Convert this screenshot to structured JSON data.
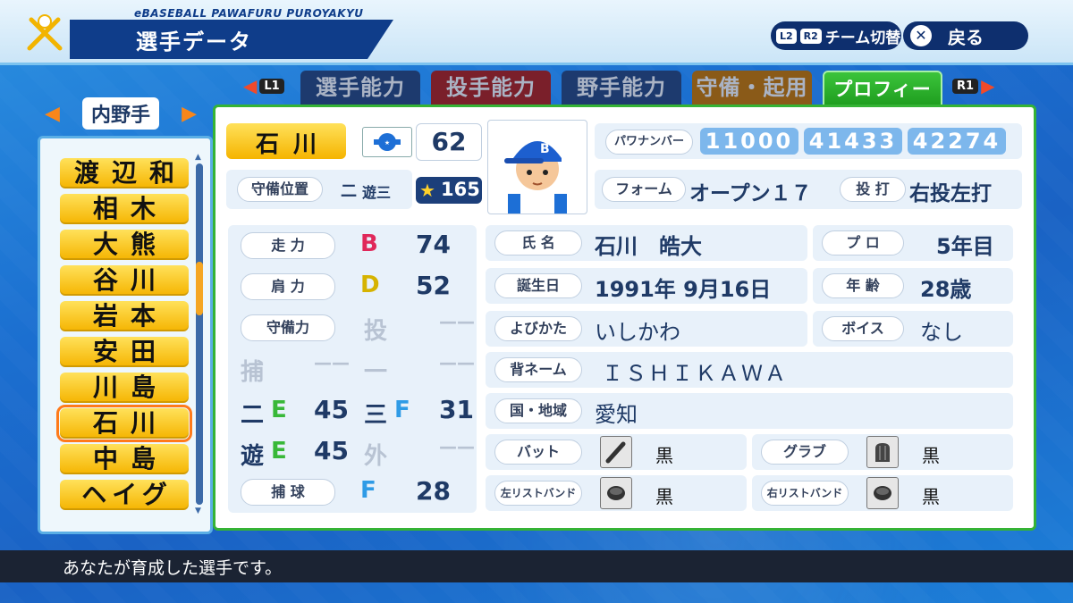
{
  "header": {
    "brand": "eBASEBALL PAWAFURU PUROYAKYU",
    "title": "選手データ",
    "team_switch_keys": [
      "L2",
      "R2"
    ],
    "team_switch_label": "チーム切替",
    "back_label": "戻る"
  },
  "tabs": {
    "left_key": "L1",
    "right_key": "R1",
    "items": [
      {
        "label": "選手能力",
        "color": "#1d3a6e"
      },
      {
        "label": "投手能力",
        "color": "#7a1f2a"
      },
      {
        "label": "野手能力",
        "color": "#1d3a6e"
      },
      {
        "label": "守備・起用",
        "color": "#8a5a18"
      },
      {
        "label": "プロフィール",
        "color": "#2aa82a",
        "active": true
      }
    ]
  },
  "position_selector": {
    "label": "内野手"
  },
  "player_list": [
    "渡辺和",
    "相木",
    "大熊",
    "谷川",
    "岩本",
    "安田",
    "川島",
    "石川",
    "中島",
    "ヘイグ"
  ],
  "selected_index": 7,
  "player": {
    "name": "石川",
    "number": "62",
    "position_label": "守備位置",
    "position_main": "二",
    "position_sub": "遊三",
    "rating": "165",
    "pawa_label": "パワナンバー",
    "pawa_numbers": [
      "11000",
      "41433",
      "42274"
    ],
    "form_label": "フォーム",
    "form_value": "オープン１７",
    "throw_bat_label": "投 打",
    "throw_bat_value": "右投左打",
    "speed": {
      "label": "走 力",
      "grade": "B",
      "value": "74"
    },
    "arm": {
      "label": "肩 力",
      "grade": "D",
      "value": "52"
    },
    "fielding": {
      "label": "守備力",
      "pitcher": {
        "pos": "投",
        "value": "——"
      },
      "catcher": {
        "pos": "捕",
        "value": "——"
      },
      "first": {
        "pos": "一",
        "value": "——"
      },
      "second": {
        "pos": "二",
        "grade": "E",
        "value": "45"
      },
      "third": {
        "pos": "三",
        "grade": "F",
        "value": "31"
      },
      "short": {
        "pos": "遊",
        "grade": "E",
        "value": "45"
      },
      "outfield": {
        "pos": "外",
        "value": "——"
      }
    },
    "catching": {
      "label": "捕 球",
      "grade": "F",
      "value": "28"
    },
    "profile": {
      "name_label": "氏 名",
      "name_value": "石川　皓大",
      "pro_label": "プ ロ",
      "pro_value": "5年目",
      "birth_label": "誕生日",
      "birth_value": "1991年 9月16日",
      "age_label": "年 齢",
      "age_value": "28歳",
      "reading_label": "よびかた",
      "reading_value": "いしかわ",
      "voice_label": "ボイス",
      "voice_value": "なし",
      "back_name_label": "背ネーム",
      "back_name_value": "ＩＳＨＩＫＡＷＡ",
      "region_label": "国・地域",
      "region_value": "愛知"
    },
    "equipment": {
      "bat_label": "バット",
      "bat_value": "黒",
      "glove_label": "グラブ",
      "glove_value": "黒",
      "left_wrist_label": "左リストバンド",
      "left_wrist_value": "黒",
      "right_wrist_label": "右リストバンド",
      "right_wrist_value": "黒"
    }
  },
  "footer": {
    "message": "あなたが育成した選手です。"
  }
}
